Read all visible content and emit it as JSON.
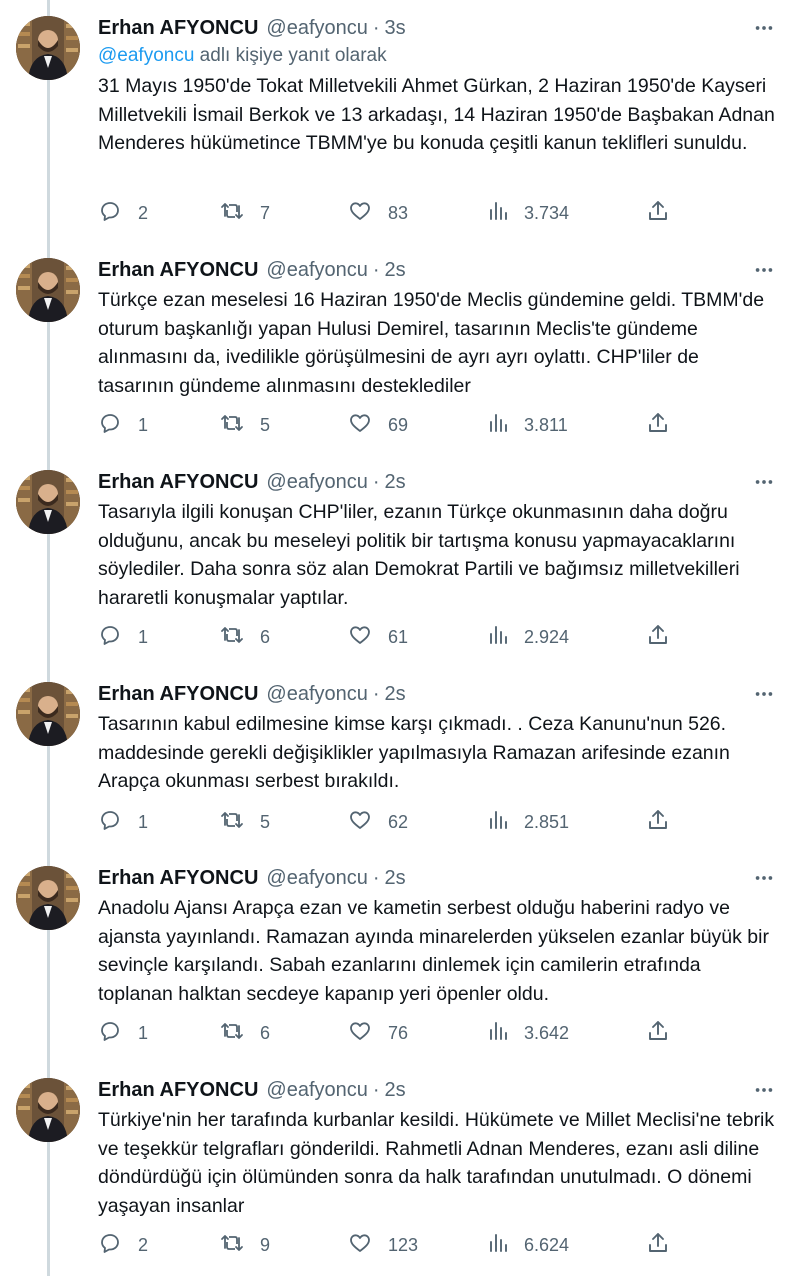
{
  "colors": {
    "text": "#0f1419",
    "muted": "#536471",
    "link": "#1d9bf0",
    "thread_line": "#cfd9de"
  },
  "icons": {
    "reply": "comment-icon",
    "retweet": "retweet-icon",
    "like": "heart-icon",
    "views": "views-chart-icon",
    "share": "share-upload-icon",
    "more": "more-dots-icon"
  },
  "tweets": [
    {
      "author": "Erhan AFYONCU",
      "handle": "@eafyoncu",
      "separator": "·",
      "time": "3s",
      "reply_to_mention": "@eafyoncu",
      "reply_to_suffix": " adlı kişiye yanıt olarak",
      "text": "31 Mayıs 1950'de Tokat Milletvekili Ahmet Gürkan, 2 Haziran 1950'de Kayseri Milletvekili İsmail Berkok ve 13 arkadaşı, 14 Haziran 1950'de Başbakan Adnan Menderes hükümetince TBMM'ye bu konuda çeşitli kanun teklifleri sunuldu.",
      "replies": "2",
      "retweets": "7",
      "likes": "83",
      "views": "3.734"
    },
    {
      "author": "Erhan AFYONCU",
      "handle": "@eafyoncu",
      "separator": "·",
      "time": "2s",
      "text": "Türkçe ezan meselesi 16 Haziran 1950'de Meclis gündemine geldi. TBMM'de oturum başkanlığı yapan Hulusi Demirel, tasarının Meclis'te gündeme alınmasını da, ivedilikle görüşülmesini de ayrı ayrı oylattı. CHP'liler de tasarının gündeme alınmasını desteklediler",
      "replies": "1",
      "retweets": "5",
      "likes": "69",
      "views": "3.811"
    },
    {
      "author": "Erhan AFYONCU",
      "handle": "@eafyoncu",
      "separator": "·",
      "time": "2s",
      "text": "Tasarıyla ilgili konuşan CHP'liler, ezanın Türkçe okunmasının daha doğru olduğunu, ancak bu meseleyi politik bir tartışma konusu yapmayacaklarını söylediler. Daha sonra söz alan Demokrat Partili ve bağımsız milletvekilleri hararetli konuşmalar yaptılar.",
      "replies": "1",
      "retweets": "6",
      "likes": "61",
      "views": "2.924"
    },
    {
      "author": "Erhan AFYONCU",
      "handle": "@eafyoncu",
      "separator": "·",
      "time": "2s",
      "text": "Tasarının kabul edilmesine kimse karşı çıkmadı. . Ceza Kanunu'nun 526. maddesinde gerekli değişiklikler yapılmasıyla Ramazan arifesinde ezanın Arapça okunması serbest bırakıldı.",
      "replies": "1",
      "retweets": "5",
      "likes": "62",
      "views": "2.851"
    },
    {
      "author": "Erhan AFYONCU",
      "handle": "@eafyoncu",
      "separator": "·",
      "time": "2s",
      "text": "Anadolu Ajansı  Arapça ezan ve kametin serbest olduğu haberini radyo ve ajansta yayınlandı. Ramazan ayında minarelerden yükselen ezanlar büyük bir sevinçle karşılandı. Sabah ezanlarını dinlemek için camilerin etrafında toplanan halktan secdeye kapanıp yeri öpenler oldu.",
      "replies": "1",
      "retweets": "6",
      "likes": "76",
      "views": "3.642"
    },
    {
      "author": "Erhan AFYONCU",
      "handle": "@eafyoncu",
      "separator": "·",
      "time": "2s",
      "text": "Türkiye'nin her tarafında kurbanlar kesildi. Hükümete ve Millet Meclisi'ne tebrik ve teşekkür telgrafları gönderildi. Rahmetli Adnan Menderes, ezanı asli diline döndürdüğü için ölümünden sonra da halk tarafından unutulmadı. O dönemi yaşayan insanlar",
      "replies": "2",
      "retweets": "9",
      "likes": "123",
      "views": "6.624"
    }
  ]
}
